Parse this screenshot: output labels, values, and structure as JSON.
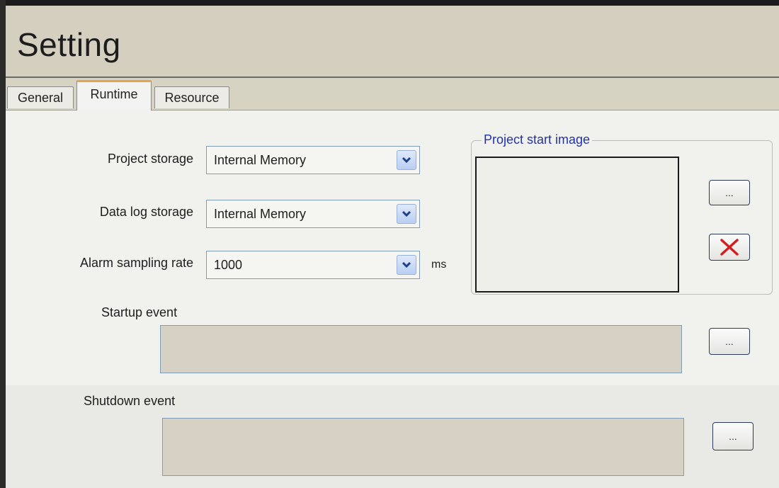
{
  "header": {
    "title": "Setting"
  },
  "tabs": [
    {
      "label": "General"
    },
    {
      "label": "Runtime"
    },
    {
      "label": "Resource"
    }
  ],
  "runtime": {
    "project_storage": {
      "label": "Project storage",
      "value": "Internal Memory"
    },
    "data_log_storage": {
      "label": "Data log storage",
      "value": "Internal Memory"
    },
    "alarm_sampling_rate": {
      "label": "Alarm sampling rate",
      "value": "1000",
      "unit": "ms"
    },
    "project_start_image": {
      "title": "Project start image",
      "browse_label": "...",
      "clear_icon": "red-x-icon"
    },
    "startup_event": {
      "label": "Startup event",
      "value": "",
      "browse_label": "..."
    },
    "shutdown_event": {
      "label": "Shutdown event",
      "value": "",
      "browse_label": "..."
    }
  },
  "colors": {
    "header_bg": "#d4cfbf",
    "active_tab_accent": "#e7a34d",
    "groupbox_title": "#2233a6",
    "event_field_bg": "#d6d1c2",
    "clear_icon": "#d21e1e"
  }
}
